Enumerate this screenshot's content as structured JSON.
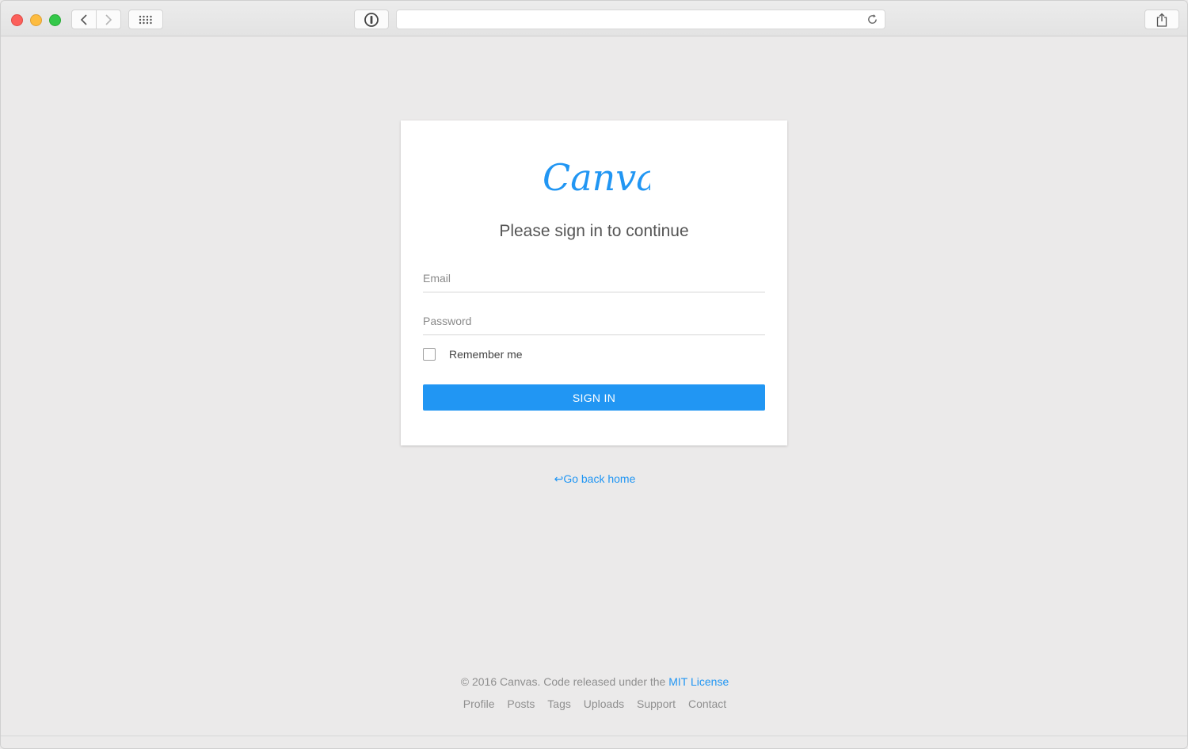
{
  "browser": {
    "address_value": "",
    "buttons": [
      "back",
      "forward",
      "tab-overview",
      "password-manager",
      "reload",
      "share"
    ]
  },
  "login": {
    "logo_text": "Canvas",
    "heading": "Please sign in to continue",
    "email_placeholder": "Email",
    "email_value": "",
    "password_placeholder": "Password",
    "password_value": "",
    "remember_label": "Remember me",
    "remember_checked": false,
    "submit_label": "SIGN IN"
  },
  "go_back": {
    "arrow": "↩",
    "label": "Go back home"
  },
  "footer": {
    "copyright_prefix": "© 2016 Canvas. Code released under the",
    "license_link": "MIT License",
    "links": [
      "Profile",
      "Posts",
      "Tags",
      "Uploads",
      "Support",
      "Contact"
    ]
  },
  "colors": {
    "accent": "#2196f3",
    "page_background": "#ebeaea",
    "card_background": "#ffffff"
  }
}
